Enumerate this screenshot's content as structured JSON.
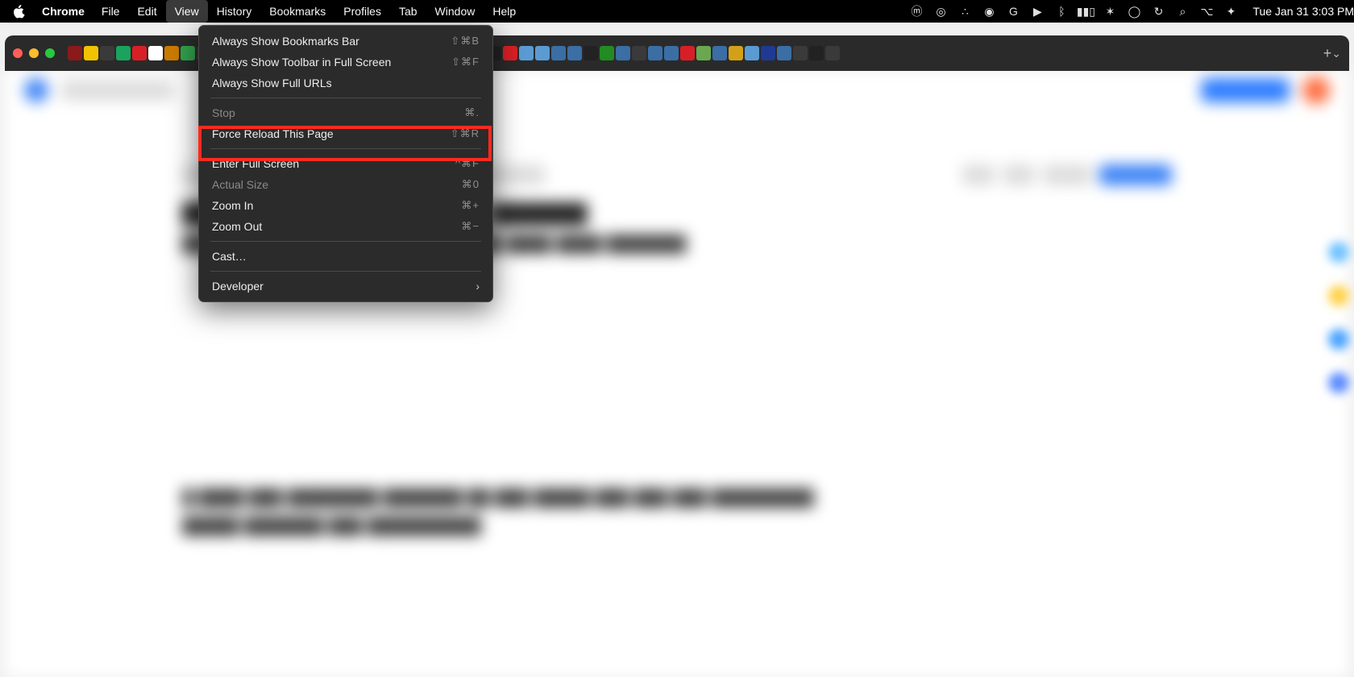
{
  "menubar": {
    "app": "Chrome",
    "menus": [
      "File",
      "Edit",
      "View",
      "History",
      "Bookmarks",
      "Profiles",
      "Tab",
      "Window",
      "Help"
    ],
    "active_menu_index": 2,
    "clock": "Tue Jan 31  3:03 PM",
    "status_icons": [
      "mk",
      "cc",
      "dots",
      "record",
      "G",
      "play-circle",
      "bluetooth",
      "battery",
      "wifi",
      "user-circle",
      "time-machine",
      "search",
      "control-center",
      "siri"
    ]
  },
  "traffic_lights": [
    "close",
    "minimize",
    "fullscreen"
  ],
  "tab_strip": {
    "favicon_colors": [
      "#8b1a1a",
      "#f2c200",
      "#3a3a3a",
      "#1aa35c",
      "#d81f26",
      "#ffffff",
      "#cc7a00",
      "#31a24c",
      "#3a3a3a",
      "#222222",
      "#f2a900",
      "#ffffff",
      "#bbbbbb",
      "#2e8b57",
      "#2e8b57",
      "#3a3a3a",
      "#e07b00",
      "#e07b00",
      "#e07b00",
      "#5a9bd4",
      "#5a9bd4",
      "#222222",
      "#2e8b57",
      "#3a6ea5",
      "#1177dd",
      "#5a9bd4",
      "#222222",
      "#d81f26",
      "#5a9bd4",
      "#5a9bd4",
      "#3a6ea5",
      "#3a6ea5",
      "#222222",
      "#228b22",
      "#3a6ea5",
      "#3a3a3a",
      "#3a6ea5",
      "#3a6ea5",
      "#d81f26",
      "#6aa84f",
      "#3a6ea5",
      "#d4a017",
      "#5a9bd4",
      "#1f3a93",
      "#3a6ea5",
      "#3a3a3a",
      "#222222",
      "#3a3a3a"
    ],
    "new_tab_label": "+",
    "overflow_label": "⌄"
  },
  "dropdown": {
    "groups": [
      [
        {
          "label": "Always Show Bookmarks Bar",
          "shortcut": "⇧⌘B",
          "enabled": true
        },
        {
          "label": "Always Show Toolbar in Full Screen",
          "shortcut": "⇧⌘F",
          "enabled": true
        },
        {
          "label": "Always Show Full URLs",
          "shortcut": "",
          "enabled": true
        }
      ],
      [
        {
          "label": "Stop",
          "shortcut": "⌘.",
          "enabled": false
        },
        {
          "label": "Force Reload This Page",
          "shortcut": "⇧⌘R",
          "enabled": true,
          "highlighted": true
        }
      ],
      [
        {
          "label": "Enter Full Screen",
          "shortcut": "^⌘F",
          "enabled": true
        },
        {
          "label": "Actual Size",
          "shortcut": "⌘0",
          "enabled": false
        },
        {
          "label": "Zoom In",
          "shortcut": "⌘+",
          "enabled": true
        },
        {
          "label": "Zoom Out",
          "shortcut": "⌘−",
          "enabled": true
        }
      ],
      [
        {
          "label": "Cast…",
          "shortcut": "",
          "enabled": true
        }
      ],
      [
        {
          "label": "Developer",
          "shortcut": "",
          "enabled": true,
          "submenu": true
        }
      ]
    ]
  },
  "side_colors": [
    "#6fc2ff",
    "#ffd24a",
    "#4aa3ff",
    "#5b8bff"
  ]
}
